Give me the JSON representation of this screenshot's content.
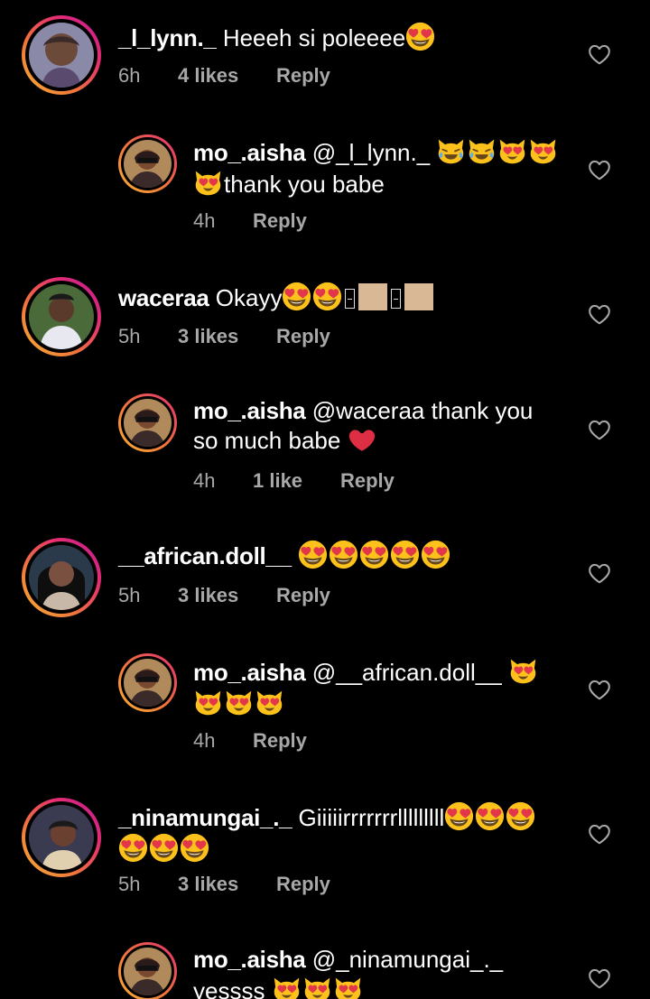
{
  "comments": [
    {
      "username": "_l_lynn._",
      "text": "Heeeh si poleeee",
      "emoji": [
        "heart-eyes"
      ],
      "time": "6h",
      "likes": "4 likes",
      "reply": "Reply"
    },
    {
      "username": "mo_.aisha",
      "text": "@_l_lynn._",
      "emoji_line1": [
        "joy-cat",
        "joy-cat",
        "heart-eyes-cat",
        "heart-eyes-cat"
      ],
      "text2": "thank you babe",
      "emoji_line2": [
        "heart-eyes-cat"
      ],
      "time": "4h",
      "reply": "Reply"
    },
    {
      "username": "waceraa",
      "text": "Okayy",
      "emoji": [
        "heart-eyes",
        "heart-eyes",
        "missing-glyph",
        "skin-tone",
        "missing-glyph",
        "skin-tone"
      ],
      "time": "5h",
      "likes": "3 likes",
      "reply": "Reply"
    },
    {
      "username": "mo_.aisha",
      "text": "@waceraa thank you",
      "text2": "so much babe",
      "emoji_line2": [
        "red-heart"
      ],
      "time": "4h",
      "likes": "1 like",
      "reply": "Reply"
    },
    {
      "username": "__african.doll__",
      "text": "",
      "emoji": [
        "heart-eyes",
        "heart-eyes",
        "heart-eyes",
        "heart-eyes",
        "heart-eyes"
      ],
      "time": "5h",
      "likes": "3 likes",
      "reply": "Reply"
    },
    {
      "username": "mo_.aisha",
      "text": "@__african.doll__",
      "emoji_line1": [
        "heart-eyes-cat"
      ],
      "emoji_line2": [
        "heart-eyes-cat",
        "heart-eyes-cat",
        "heart-eyes-cat"
      ],
      "time": "4h",
      "reply": "Reply"
    },
    {
      "username": "_ninamungai_._",
      "text": "Giiiiirrrrrrrlllllllll",
      "emoji_line1": [
        "heart-eyes",
        "heart-eyes",
        "heart-eyes"
      ],
      "emoji_line2": [
        "heart-eyes",
        "heart-eyes",
        "heart-eyes"
      ],
      "time": "5h",
      "likes": "3 likes",
      "reply": "Reply"
    },
    {
      "username": "mo_.aisha",
      "text": "@_ninamungai_._",
      "text2": "yessss",
      "emoji_line2": [
        "heart-eyes-cat",
        "heart-eyes-cat",
        "heart-eyes-cat"
      ]
    }
  ],
  "icons": {
    "like": "heart-outline-icon"
  },
  "colors": {
    "background": "#000000",
    "text": "#ffffff",
    "meta": "#a8a8a8",
    "ring_start": "#f9b233",
    "ring_end": "#c1189c"
  }
}
